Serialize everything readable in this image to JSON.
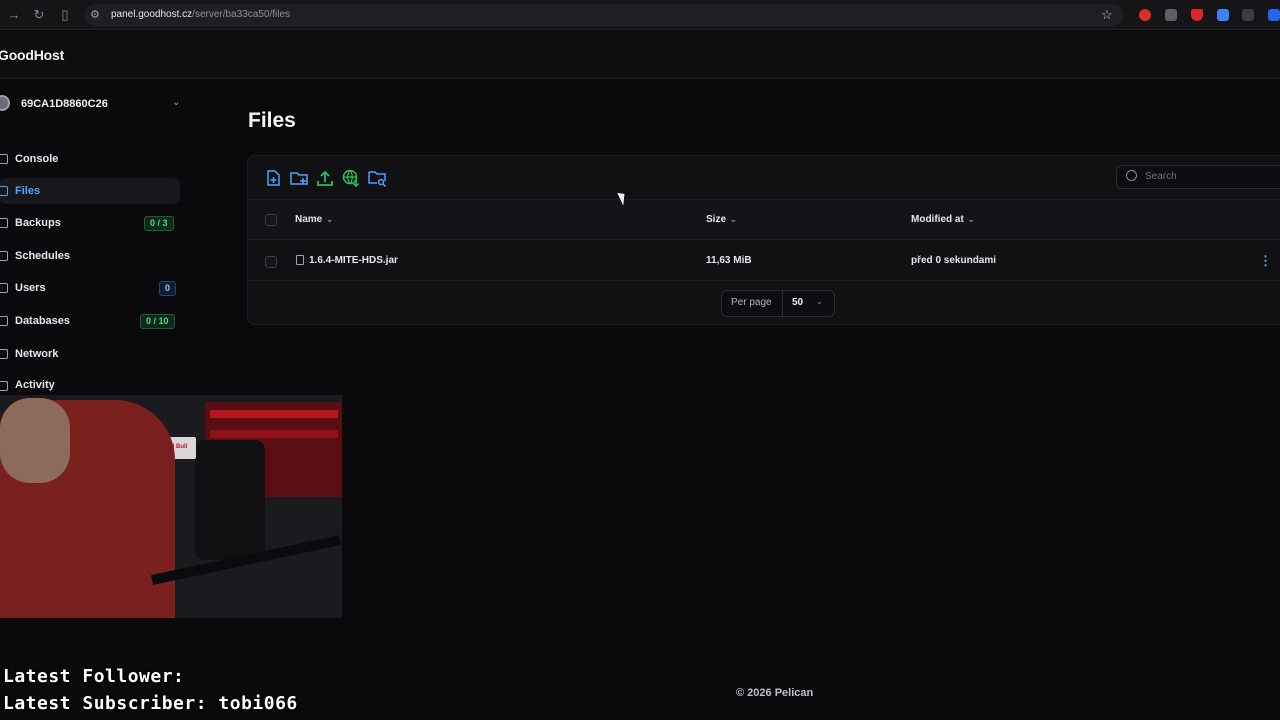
{
  "browser": {
    "url_host": "panel.goodhost.cz",
    "url_path": "/server/ba33ca50/files"
  },
  "app": {
    "brand": "GoodHost"
  },
  "sidebar": {
    "server_name": "69CA1D8860C26",
    "items": [
      {
        "label": "Console"
      },
      {
        "label": "Files",
        "active": true
      },
      {
        "label": "Backups",
        "badge": "0 / 3"
      },
      {
        "label": "Schedules"
      },
      {
        "label": "Users",
        "badge": "0"
      },
      {
        "label": "Databases",
        "badge": "0 / 10"
      },
      {
        "label": "Network"
      },
      {
        "label": "Activity"
      }
    ]
  },
  "main": {
    "title": "Files",
    "search_placeholder": "Search",
    "toolbar_icons": [
      "new-file-icon",
      "new-folder-icon",
      "upload-icon",
      "pull-remote-icon",
      "search-folder-icon"
    ],
    "columns": [
      "Name",
      "Size",
      "Modified at"
    ],
    "rows": [
      {
        "name": "1.6.4-MITE-HDS.jar",
        "size": "11,63 MiB",
        "modified": "před 0 sekundami"
      }
    ],
    "per_page_label": "Per page",
    "per_page_value": "50"
  },
  "footer": {
    "text": "© 2026 Pelican"
  },
  "overlay": {
    "follower": "Latest Follower:",
    "subscriber": "Latest Subscriber: tobi066",
    "webcam_box_text": "Red Bull"
  },
  "colors": {
    "accent": "#4da3ff",
    "badge_green": "#4ade80",
    "toolbar_green": "#22c55e"
  }
}
